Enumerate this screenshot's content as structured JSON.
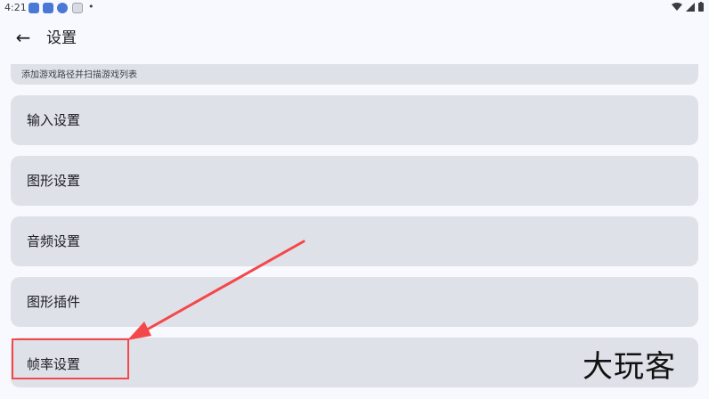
{
  "status_bar": {
    "time": "4:21",
    "left_icons": [
      "app-notification-icon",
      "app-notification-icon",
      "download-icon",
      "shield-icon"
    ],
    "dot": "•",
    "right_icons": [
      "wifi-icon",
      "signal-icon",
      "battery-icon"
    ]
  },
  "app_bar": {
    "back_icon": "←",
    "title": "设置"
  },
  "items": {
    "scan": {
      "subtitle": "添加游戏路径并扫描游戏列表"
    },
    "input": {
      "label": "输入设置"
    },
    "graphics": {
      "label": "图形设置"
    },
    "audio": {
      "label": "音频设置"
    },
    "plugins": {
      "label": "图形插件"
    },
    "framerate": {
      "label": "帧率设置"
    }
  },
  "annotation": {
    "color": "#f4474a"
  },
  "watermark": {
    "text": "大玩客"
  }
}
